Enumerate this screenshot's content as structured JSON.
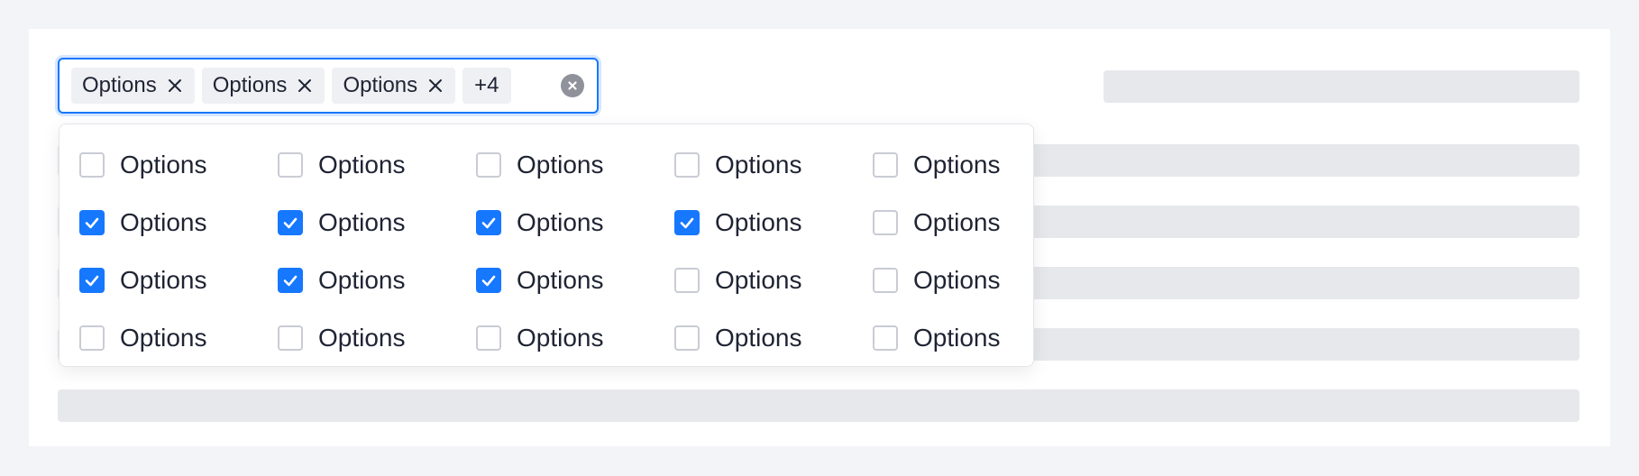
{
  "select": {
    "tags": [
      {
        "label": "Options"
      },
      {
        "label": "Options"
      },
      {
        "label": "Options"
      }
    ],
    "more_label": "+4"
  },
  "options": [
    [
      {
        "label": "Options",
        "checked": false
      },
      {
        "label": "Options",
        "checked": false
      },
      {
        "label": "Options",
        "checked": false
      },
      {
        "label": "Options",
        "checked": false
      },
      {
        "label": "Options",
        "checked": false
      }
    ],
    [
      {
        "label": "Options",
        "checked": true
      },
      {
        "label": "Options",
        "checked": true
      },
      {
        "label": "Options",
        "checked": true
      },
      {
        "label": "Options",
        "checked": true
      },
      {
        "label": "Options",
        "checked": false
      }
    ],
    [
      {
        "label": "Options",
        "checked": true
      },
      {
        "label": "Options",
        "checked": true
      },
      {
        "label": "Options",
        "checked": true
      },
      {
        "label": "Options",
        "checked": false
      },
      {
        "label": "Options",
        "checked": false
      }
    ],
    [
      {
        "label": "Options",
        "checked": false
      },
      {
        "label": "Options",
        "checked": false
      },
      {
        "label": "Options",
        "checked": false
      },
      {
        "label": "Options",
        "checked": false
      },
      {
        "label": "Options",
        "checked": false
      }
    ]
  ],
  "colors": {
    "accent": "#1677ff",
    "skeleton": "#e7e8ec",
    "tag_background": "#eef0f4",
    "text": "#1f2433"
  },
  "icons": {
    "tag_remove": "close-icon",
    "clear": "clear-circle-icon",
    "checked": "checkmark-icon"
  }
}
